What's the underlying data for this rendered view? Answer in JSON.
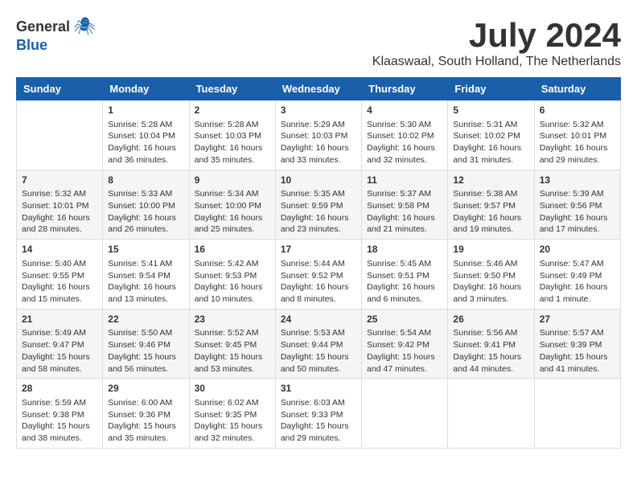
{
  "header": {
    "logo_general": "General",
    "logo_blue": "Blue",
    "month_title": "July 2024",
    "location": "Klaaswaal, South Holland, The Netherlands"
  },
  "days_of_week": [
    "Sunday",
    "Monday",
    "Tuesday",
    "Wednesday",
    "Thursday",
    "Friday",
    "Saturday"
  ],
  "weeks": [
    [
      {
        "day": "",
        "content": ""
      },
      {
        "day": "1",
        "content": "Sunrise: 5:28 AM\nSunset: 10:04 PM\nDaylight: 16 hours\nand 36 minutes."
      },
      {
        "day": "2",
        "content": "Sunrise: 5:28 AM\nSunset: 10:03 PM\nDaylight: 16 hours\nand 35 minutes."
      },
      {
        "day": "3",
        "content": "Sunrise: 5:29 AM\nSunset: 10:03 PM\nDaylight: 16 hours\nand 33 minutes."
      },
      {
        "day": "4",
        "content": "Sunrise: 5:30 AM\nSunset: 10:02 PM\nDaylight: 16 hours\nand 32 minutes."
      },
      {
        "day": "5",
        "content": "Sunrise: 5:31 AM\nSunset: 10:02 PM\nDaylight: 16 hours\nand 31 minutes."
      },
      {
        "day": "6",
        "content": "Sunrise: 5:32 AM\nSunset: 10:01 PM\nDaylight: 16 hours\nand 29 minutes."
      }
    ],
    [
      {
        "day": "7",
        "content": "Sunrise: 5:32 AM\nSunset: 10:01 PM\nDaylight: 16 hours\nand 28 minutes."
      },
      {
        "day": "8",
        "content": "Sunrise: 5:33 AM\nSunset: 10:00 PM\nDaylight: 16 hours\nand 26 minutes."
      },
      {
        "day": "9",
        "content": "Sunrise: 5:34 AM\nSunset: 10:00 PM\nDaylight: 16 hours\nand 25 minutes."
      },
      {
        "day": "10",
        "content": "Sunrise: 5:35 AM\nSunset: 9:59 PM\nDaylight: 16 hours\nand 23 minutes."
      },
      {
        "day": "11",
        "content": "Sunrise: 5:37 AM\nSunset: 9:58 PM\nDaylight: 16 hours\nand 21 minutes."
      },
      {
        "day": "12",
        "content": "Sunrise: 5:38 AM\nSunset: 9:57 PM\nDaylight: 16 hours\nand 19 minutes."
      },
      {
        "day": "13",
        "content": "Sunrise: 5:39 AM\nSunset: 9:56 PM\nDaylight: 16 hours\nand 17 minutes."
      }
    ],
    [
      {
        "day": "14",
        "content": "Sunrise: 5:40 AM\nSunset: 9:55 PM\nDaylight: 16 hours\nand 15 minutes."
      },
      {
        "day": "15",
        "content": "Sunrise: 5:41 AM\nSunset: 9:54 PM\nDaylight: 16 hours\nand 13 minutes."
      },
      {
        "day": "16",
        "content": "Sunrise: 5:42 AM\nSunset: 9:53 PM\nDaylight: 16 hours\nand 10 minutes."
      },
      {
        "day": "17",
        "content": "Sunrise: 5:44 AM\nSunset: 9:52 PM\nDaylight: 16 hours\nand 8 minutes."
      },
      {
        "day": "18",
        "content": "Sunrise: 5:45 AM\nSunset: 9:51 PM\nDaylight: 16 hours\nand 6 minutes."
      },
      {
        "day": "19",
        "content": "Sunrise: 5:46 AM\nSunset: 9:50 PM\nDaylight: 16 hours\nand 3 minutes."
      },
      {
        "day": "20",
        "content": "Sunrise: 5:47 AM\nSunset: 9:49 PM\nDaylight: 16 hours\nand 1 minute."
      }
    ],
    [
      {
        "day": "21",
        "content": "Sunrise: 5:49 AM\nSunset: 9:47 PM\nDaylight: 15 hours\nand 58 minutes."
      },
      {
        "day": "22",
        "content": "Sunrise: 5:50 AM\nSunset: 9:46 PM\nDaylight: 15 hours\nand 56 minutes."
      },
      {
        "day": "23",
        "content": "Sunrise: 5:52 AM\nSunset: 9:45 PM\nDaylight: 15 hours\nand 53 minutes."
      },
      {
        "day": "24",
        "content": "Sunrise: 5:53 AM\nSunset: 9:44 PM\nDaylight: 15 hours\nand 50 minutes."
      },
      {
        "day": "25",
        "content": "Sunrise: 5:54 AM\nSunset: 9:42 PM\nDaylight: 15 hours\nand 47 minutes."
      },
      {
        "day": "26",
        "content": "Sunrise: 5:56 AM\nSunset: 9:41 PM\nDaylight: 15 hours\nand 44 minutes."
      },
      {
        "day": "27",
        "content": "Sunrise: 5:57 AM\nSunset: 9:39 PM\nDaylight: 15 hours\nand 41 minutes."
      }
    ],
    [
      {
        "day": "28",
        "content": "Sunrise: 5:59 AM\nSunset: 9:38 PM\nDaylight: 15 hours\nand 38 minutes."
      },
      {
        "day": "29",
        "content": "Sunrise: 6:00 AM\nSunset: 9:36 PM\nDaylight: 15 hours\nand 35 minutes."
      },
      {
        "day": "30",
        "content": "Sunrise: 6:02 AM\nSunset: 9:35 PM\nDaylight: 15 hours\nand 32 minutes."
      },
      {
        "day": "31",
        "content": "Sunrise: 6:03 AM\nSunset: 9:33 PM\nDaylight: 15 hours\nand 29 minutes."
      },
      {
        "day": "",
        "content": ""
      },
      {
        "day": "",
        "content": ""
      },
      {
        "day": "",
        "content": ""
      }
    ]
  ]
}
